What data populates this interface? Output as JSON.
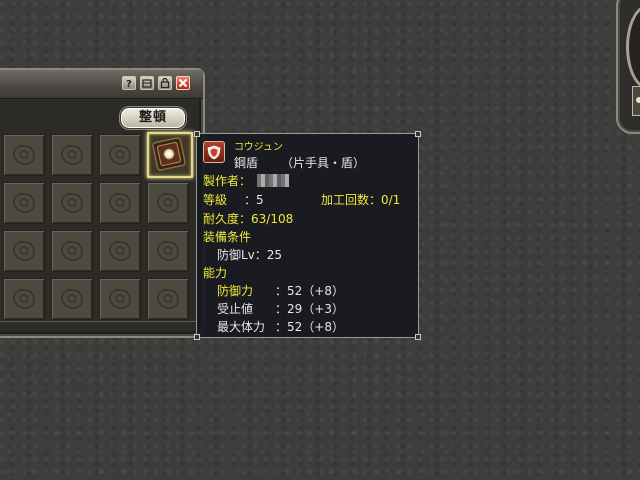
{
  "inventory": {
    "titlebar_buttons": [
      {
        "name": "help-button",
        "icon": "question-icon"
      },
      {
        "name": "minimize-button",
        "icon": "minimize-icon"
      },
      {
        "name": "lock-button",
        "icon": "lock-icon"
      },
      {
        "name": "close-button",
        "icon": "close-icon"
      }
    ],
    "sort_label": "整頓",
    "selected_item_icon": "shield-icon",
    "grid_rows": 4,
    "grid_cols": 4
  },
  "tooltip": {
    "item_icon": "shield-badge-icon",
    "item_reading": "コウジュン",
    "item_name": "鋼盾",
    "item_type": "（片手具・盾）",
    "maker_label": "製作者：",
    "grade_label": "等級",
    "grade_value": "：5",
    "craft_label": "加工回数：0/1",
    "durability_label": "耐久度：63/108",
    "requirement_header": "装備条件",
    "requirement_line": "防御Lv：25",
    "stats_header": "能力",
    "stats": [
      {
        "label": "防御力",
        "value": "：52（+8）"
      },
      {
        "label": "受止値",
        "value": "：29（+3）"
      },
      {
        "label": "最大体力",
        "value": "：52（+8）"
      }
    ]
  },
  "colors": {
    "highlight_yellow": "#f0ea3c",
    "tooltip_bg": "#16181e",
    "slot_bg": "#4d4a40",
    "selected_border": "#e6d98a"
  }
}
